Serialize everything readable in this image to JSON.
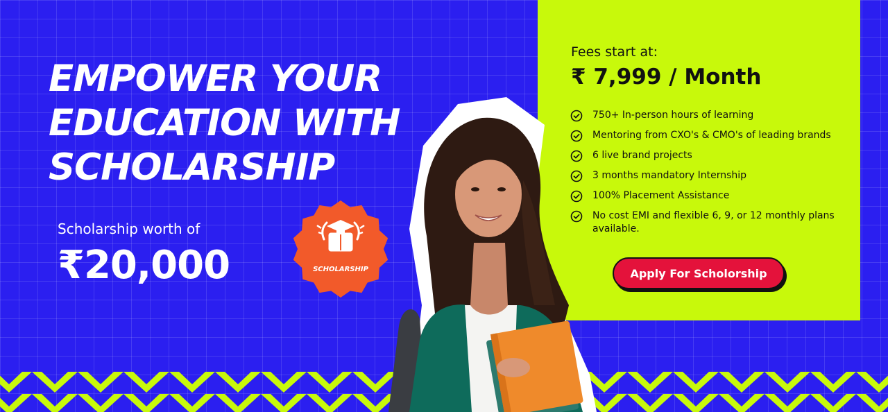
{
  "hero": {
    "headline": [
      "EMPOWER YOUR",
      "EDUCATION WITH",
      "SCHOLARSHIP"
    ],
    "worth_label": "Scholarship worth of",
    "worth_amount": "₹20,000"
  },
  "badge": {
    "label": "SCHOLARSHIP",
    "icon": "graduation-book-icon"
  },
  "card": {
    "fees_label": "Fees start at:",
    "fees_price": "₹ 7,999 / Month",
    "features": [
      "750+ In-person hours of learning",
      "Mentoring from CXO's & CMO's of leading brands",
      "6 live brand projects",
      "3 months mandatory Internship",
      "100% Placement Assistance",
      "No cost EMI and flexible 6, 9, or 12 monthly plans available."
    ],
    "apply_label": "Apply For Scholorship"
  },
  "colors": {
    "background": "#2b1ff0",
    "card": "#c8f90b",
    "accent": "#e4123b",
    "badge": "#f25a2a"
  }
}
